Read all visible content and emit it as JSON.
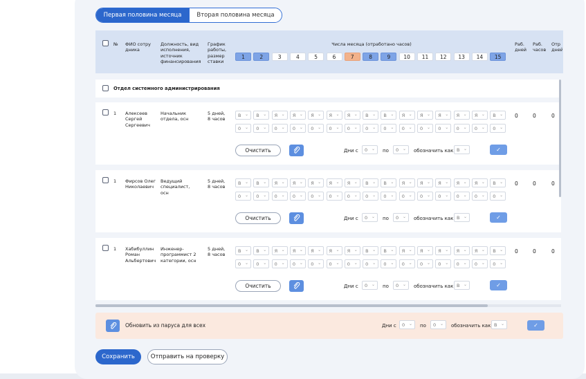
{
  "tabs": {
    "first": "Первая половина месяца",
    "second": "Вторая половина месяца"
  },
  "header": {
    "num": "№",
    "fio": "ФИО сотру дника",
    "position": "Должность, вид исполнения, источник финансирования",
    "schedule": "График работы, размер ставки",
    "days_title": "Числа месяца (отработано часов)",
    "work_days": "Раб. дней",
    "work_hours": "Раб. часов",
    "off_days": "Отр дней",
    "days": [
      {
        "n": "1",
        "style": "b"
      },
      {
        "n": "2",
        "style": "b"
      },
      {
        "n": "3",
        "style": ""
      },
      {
        "n": "4",
        "style": ""
      },
      {
        "n": "5",
        "style": ""
      },
      {
        "n": "6",
        "style": ""
      },
      {
        "n": "7",
        "style": "o"
      },
      {
        "n": "8",
        "style": "b"
      },
      {
        "n": "9",
        "style": "b"
      },
      {
        "n": "10",
        "style": ""
      },
      {
        "n": "11",
        "style": ""
      },
      {
        "n": "12",
        "style": ""
      },
      {
        "n": "13",
        "style": ""
      },
      {
        "n": "14",
        "style": ""
      },
      {
        "n": "15",
        "style": "b"
      }
    ]
  },
  "department": "Отдел системного администрирования",
  "row_labels": {
    "clear": "Очистить",
    "days_from": "Дни с",
    "to": "по",
    "mark_as": "обозначить как"
  },
  "employees": [
    {
      "num": "1",
      "name": "Алексеев Сергей Сергеевич",
      "position": "Начальник отдела, осн",
      "schedule": "5 дней, 8 часов",
      "row1": [
        "В",
        "В",
        "Я",
        "Я",
        "Я",
        "Я",
        "Я",
        "В",
        "В",
        "Я",
        "Я",
        "Я",
        "Я",
        "Я",
        "В"
      ],
      "row2": [
        "0",
        "0",
        "0",
        "0",
        "0",
        "0",
        "0",
        "0",
        "0",
        "0",
        "0",
        "0",
        "0",
        "0",
        "0"
      ],
      "from": "0",
      "to": "0",
      "mark": "В",
      "work_days": "0",
      "work_hours": "0",
      "off_days": "0"
    },
    {
      "num": "1",
      "name": "Фирсов Олег Николаевич",
      "position": "Ведущий специалист, осн",
      "schedule": "5 дней, 8 часов",
      "row1": [
        "В",
        "В",
        "Я",
        "Я",
        "Я",
        "Я",
        "Я",
        "В",
        "В",
        "Я",
        "Я",
        "Я",
        "Я",
        "Я",
        "В"
      ],
      "row2": [
        "0",
        "0",
        "0",
        "0",
        "0",
        "0",
        "0",
        "0",
        "0",
        "0",
        "0",
        "0",
        "0",
        "0",
        "0"
      ],
      "from": "0",
      "to": "0",
      "mark": "В",
      "work_days": "0",
      "work_hours": "0",
      "off_days": "0"
    },
    {
      "num": "1",
      "name": "Хабибуллин Роман Альбертович",
      "position": "Инженер-программист 2 категории, осн",
      "schedule": "5 дней, 8 часов",
      "row1": [
        "В",
        "В",
        "Я",
        "Я",
        "Я",
        "Я",
        "Я",
        "В",
        "В",
        "Я",
        "Я",
        "Я",
        "Я",
        "Я",
        "В"
      ],
      "row2": [
        "0",
        "0",
        "0",
        "0",
        "0",
        "0",
        "0",
        "0",
        "0",
        "0",
        "0",
        "0",
        "0",
        "0",
        "0"
      ],
      "from": "0",
      "to": "0",
      "mark": "В",
      "work_days": "0",
      "work_hours": "0",
      "off_days": "0"
    }
  ],
  "bottom_bar": {
    "label": "Обновить из паруса для всех",
    "days_from": "Дни с",
    "from": "0",
    "to_label": "по",
    "to": "0",
    "mark_as": "обозначить как",
    "mark": "В"
  },
  "actions": {
    "save": "Сохранить",
    "send": "Отправить на проверку"
  },
  "colors": {
    "accent": "#2c67cc",
    "weekend": "#7ea4e6",
    "holiday": "#f2b28b",
    "bar": "#fbe9df"
  }
}
